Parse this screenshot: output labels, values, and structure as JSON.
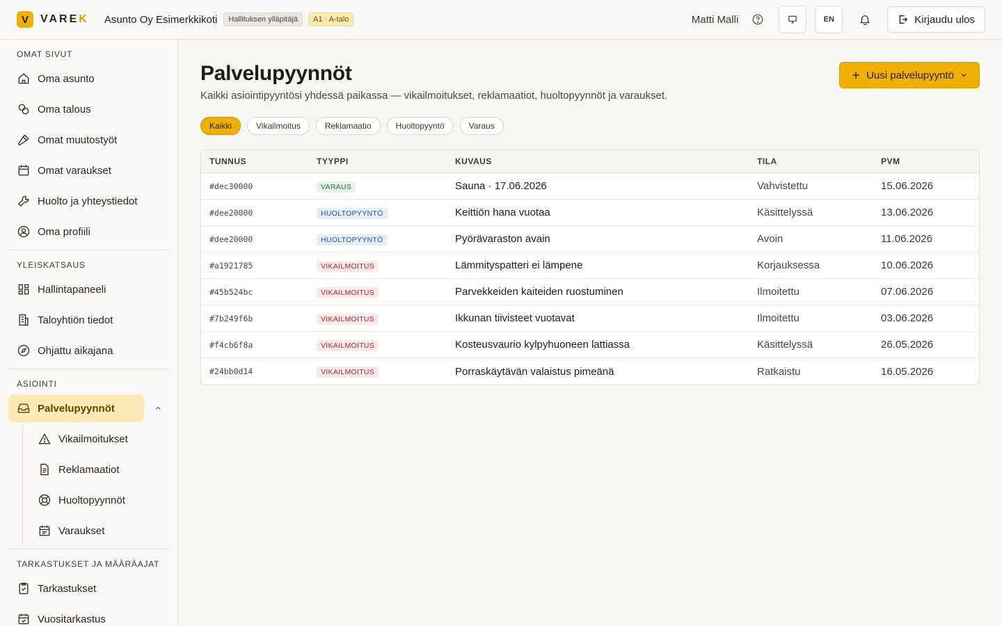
{
  "header": {
    "logo_mark": "V",
    "logo_text_main": "VARE",
    "logo_text_k": "K",
    "org_name": "Asunto Oy Esimerkkikoti",
    "role_badge": "Hallituksen ylläpitäjä",
    "apartment_badge": "A1 · A-talo",
    "user_name": "Matti Malli",
    "lang_button": "EN",
    "logout_label": "Kirjaudu ulos"
  },
  "sidebar": {
    "sections": [
      {
        "title": "OMAT SIVUT",
        "items": [
          {
            "label": "Oma asunto",
            "icon": "home-icon"
          },
          {
            "label": "Oma talous",
            "icon": "coins-icon"
          },
          {
            "label": "Omat muutostyöt",
            "icon": "hammer-icon"
          },
          {
            "label": "Omat varaukset",
            "icon": "calendar-icon"
          },
          {
            "label": "Huolto ja yhteystiedot",
            "icon": "wrench-icon"
          },
          {
            "label": "Oma profiili",
            "icon": "user-circle-icon"
          }
        ]
      },
      {
        "title": "YLEISKATSAUS",
        "items": [
          {
            "label": "Hallintapaneeli",
            "icon": "dashboard-icon"
          },
          {
            "label": "Taloyhtiön tiedot",
            "icon": "building-icon"
          },
          {
            "label": "Ohjattu aikajana",
            "icon": "compass-icon"
          }
        ]
      },
      {
        "title": "ASIOINTI",
        "active_item": {
          "label": "Palvelupyynnöt",
          "icon": "inbox-icon"
        },
        "subitems": [
          {
            "label": "Vikailmoitukset",
            "icon": "warning-icon"
          },
          {
            "label": "Reklamaatiot",
            "icon": "document-icon"
          },
          {
            "label": "Huoltopyynnöt",
            "icon": "lifebuoy-icon"
          },
          {
            "label": "Varaukset",
            "icon": "calendar-list-icon"
          }
        ]
      },
      {
        "title": "TARKASTUKSET JA MÄÄRÄAJAT",
        "items": [
          {
            "label": "Tarkastukset",
            "icon": "clipboard-check-icon"
          },
          {
            "label": "Vuositarkastus",
            "icon": "calendar-check-icon"
          }
        ]
      }
    ]
  },
  "main": {
    "title": "Palvelupyynnöt",
    "subtitle": "Kaikki asiointipyyntösi yhdessä paikassa — vikailmoitukset, reklamaatiot, huoltopyynnöt ja varaukset.",
    "new_button": "Uusi palvelupyyntö",
    "filters": [
      "Kaikki",
      "Vikailmoitus",
      "Reklamaatio",
      "Huoltopyyntö",
      "Varaus"
    ],
    "active_filter": "Kaikki",
    "columns": [
      "TUNNUS",
      "TYYPPI",
      "KUVAUS",
      "TILA",
      "PVM"
    ],
    "rows": [
      {
        "id": "#dec30000",
        "type": "VARAUS",
        "type_kind": "varaus",
        "desc": "Sauna · 17.06.2026",
        "status": "Vahvistettu",
        "date": "15.06.2026"
      },
      {
        "id": "#dee20000",
        "type": "HUOLTOPYYNTÖ",
        "type_kind": "huolto",
        "desc": "Keittiön hana vuotaa",
        "status": "Käsittelyssä",
        "date": "13.06.2026"
      },
      {
        "id": "#dee20000",
        "type": "HUOLTOPYYNTÖ",
        "type_kind": "huolto",
        "desc": "Pyörävaraston avain",
        "status": "Avoin",
        "date": "11.06.2026"
      },
      {
        "id": "#a1921785",
        "type": "VIKAILMOITUS",
        "type_kind": "vika",
        "desc": "Lämmityspatteri ei lämpene",
        "status": "Korjauksessa",
        "date": "10.06.2026"
      },
      {
        "id": "#45b524bc",
        "type": "VIKAILMOITUS",
        "type_kind": "vika",
        "desc": "Parvekkeiden kaiteiden ruostuminen",
        "status": "Ilmoitettu",
        "date": "07.06.2026"
      },
      {
        "id": "#7b249f6b",
        "type": "VIKAILMOITUS",
        "type_kind": "vika",
        "desc": "Ikkunan tiivisteet vuotavat",
        "status": "Ilmoitettu",
        "date": "03.06.2026"
      },
      {
        "id": "#f4cb6f8a",
        "type": "VIKAILMOITUS",
        "type_kind": "vika",
        "desc": "Kosteusvaurio kylpyhuoneen lattiassa",
        "status": "Käsittelyssä",
        "date": "26.05.2026"
      },
      {
        "id": "#24bb0d14",
        "type": "VIKAILMOITUS",
        "type_kind": "vika",
        "desc": "Porraskäytävän valaistus pimeänä",
        "status": "Ratkaistu",
        "date": "16.05.2026"
      }
    ]
  },
  "colors": {
    "accent": "#f0b000",
    "active_nav_bg": "#fbe9b6"
  }
}
